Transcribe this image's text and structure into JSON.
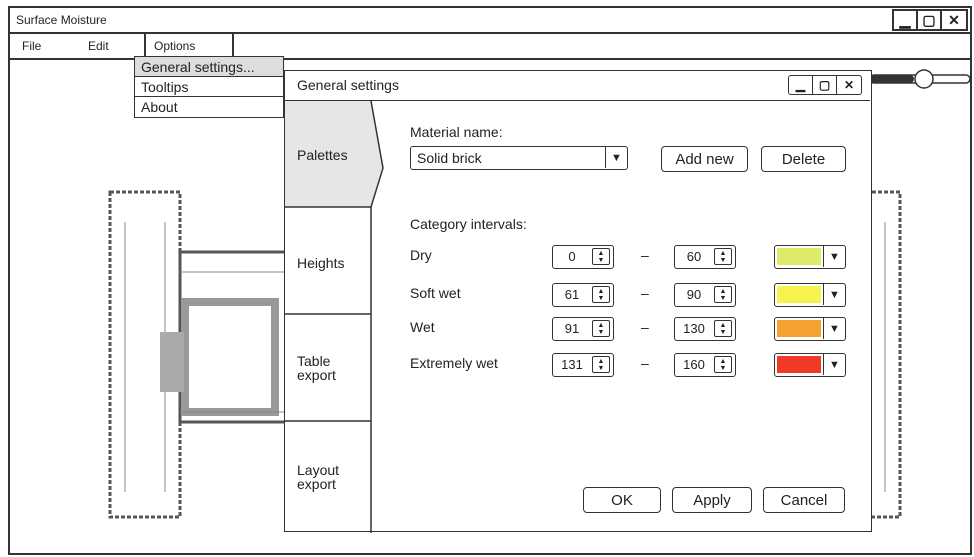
{
  "window": {
    "title": "Surface Moisture"
  },
  "menu": {
    "file": "File",
    "edit": "Edit",
    "options": "Options"
  },
  "options_menu": {
    "items": [
      "General settings...",
      "Tooltips",
      "About"
    ]
  },
  "dialog": {
    "title": "General settings",
    "tabs": [
      "Palettes",
      "Heights",
      "Table\nexport",
      "Layout\nexport"
    ],
    "material_label": "Material name:",
    "material_value": "Solid brick",
    "add_new": "Add new",
    "delete": "Delete",
    "intervals_label": "Category intervals:",
    "categories": [
      {
        "name": "Dry",
        "from": "0",
        "to": "60",
        "color": "#dfe96a"
      },
      {
        "name": "Soft wet",
        "from": "61",
        "to": "90",
        "color": "#f7f24e"
      },
      {
        "name": "Wet",
        "from": "91",
        "to": "130",
        "color": "#f5a232"
      },
      {
        "name": "Extremely wet",
        "from": "131",
        "to": "160",
        "color": "#f03a26"
      }
    ],
    "dash": "–",
    "ok": "OK",
    "apply": "Apply",
    "cancel": "Cancel"
  },
  "icons": {
    "minimize": "minimize-icon",
    "maximize": "maximize-icon",
    "close": "close-icon"
  }
}
